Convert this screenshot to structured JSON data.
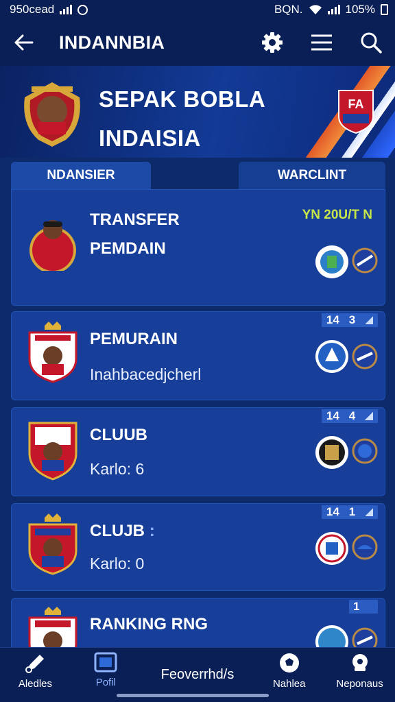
{
  "status_bar": {
    "left_text": "950cead",
    "right_text": "BQN.",
    "battery": "105%"
  },
  "app_bar": {
    "title": "INDANNBIA",
    "icons": [
      "back-arrow-icon",
      "gear-icon",
      "menu-icon",
      "search-icon"
    ]
  },
  "hero": {
    "title_line1": "SEPAK BOBLA",
    "title_line2": "INDAISIA",
    "crest_text": "FA"
  },
  "tabs": [
    {
      "label": "NDANSIER"
    },
    {
      "label": "WARCLINT"
    }
  ],
  "cards": [
    {
      "title": "TRANSFER",
      "subtitle": "PEMDAIN",
      "tag": "YN 20U/T N"
    },
    {
      "title": "PEMURAIN",
      "subtitle": "Inahbacedjcherl",
      "rank": "14",
      "rank_value": "3"
    },
    {
      "title": "CLUUB",
      "subtitle": "Karlo: 6",
      "rank": "14",
      "rank_value": "4"
    },
    {
      "title": "CLUJB",
      "title_suffix": ":",
      "subtitle": "Karlo: 0",
      "rank": "14",
      "rank_value": "1"
    },
    {
      "title": "RANKING RNG",
      "rank_value": "1"
    }
  ],
  "bottom_nav": [
    {
      "label": "Aledles",
      "icon": "pen-icon"
    },
    {
      "label": "Pofil",
      "icon": "picture-icon"
    },
    {
      "label": "Feoverrhd/s",
      "icon": ""
    },
    {
      "label": "Nahlea",
      "icon": "soccer-ball-icon"
    },
    {
      "label": "Neponaus",
      "icon": "ball-icon"
    }
  ],
  "colors": {
    "background": "#0d2a6b",
    "bar": "#0a1f55",
    "card": "#173f9a",
    "accent_tag": "#c6e64a",
    "jersey_red": "#c4172a"
  }
}
